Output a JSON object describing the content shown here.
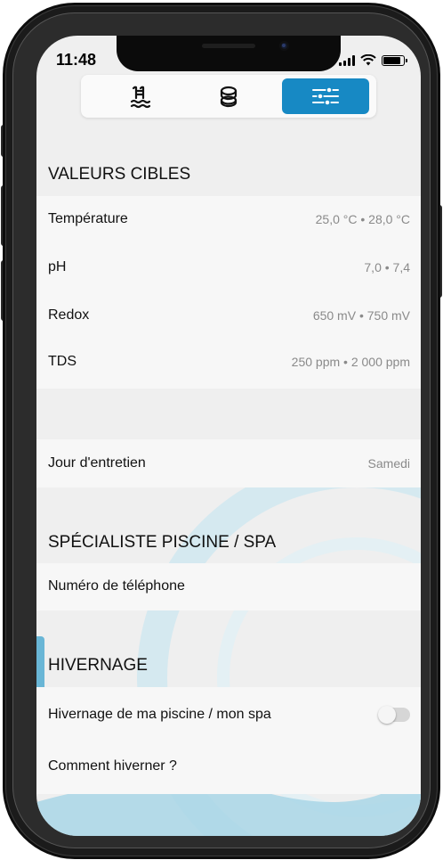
{
  "status_bar": {
    "time": "11:48"
  },
  "tabs": [
    {
      "name": "pool",
      "icon": "pool-ladder-icon",
      "active": false
    },
    {
      "name": "products",
      "icon": "tablets-icon",
      "active": false
    },
    {
      "name": "settings",
      "icon": "sliders-icon",
      "active": true
    }
  ],
  "colors": {
    "accent": "#1789c4",
    "background": "#efefef",
    "card": "#f7f7f7",
    "muted_text": "#8a8a8a",
    "decor_blue": "#a9d6e6"
  },
  "target_values": {
    "header": "VALEURS CIBLES",
    "rows": [
      {
        "label": "Température",
        "value": "25,0 °C • 28,0 °C"
      },
      {
        "label": "pH",
        "value": "7,0 • 7,4"
      },
      {
        "label": "Redox",
        "value": "650 mV • 750 mV"
      },
      {
        "label": "TDS",
        "value": "250 ppm • 2 000 ppm"
      }
    ]
  },
  "maintenance": {
    "label": "Jour d'entretien",
    "value": "Samedi"
  },
  "specialist": {
    "header": "SPÉCIALISTE PISCINE / SPA",
    "phone_label": "Numéro de téléphone"
  },
  "wintering": {
    "header": "HIVERNAGE",
    "toggle_label": "Hivernage de ma piscine / mon spa",
    "toggle_on": false,
    "howto_label": "Comment hiverner ?"
  }
}
